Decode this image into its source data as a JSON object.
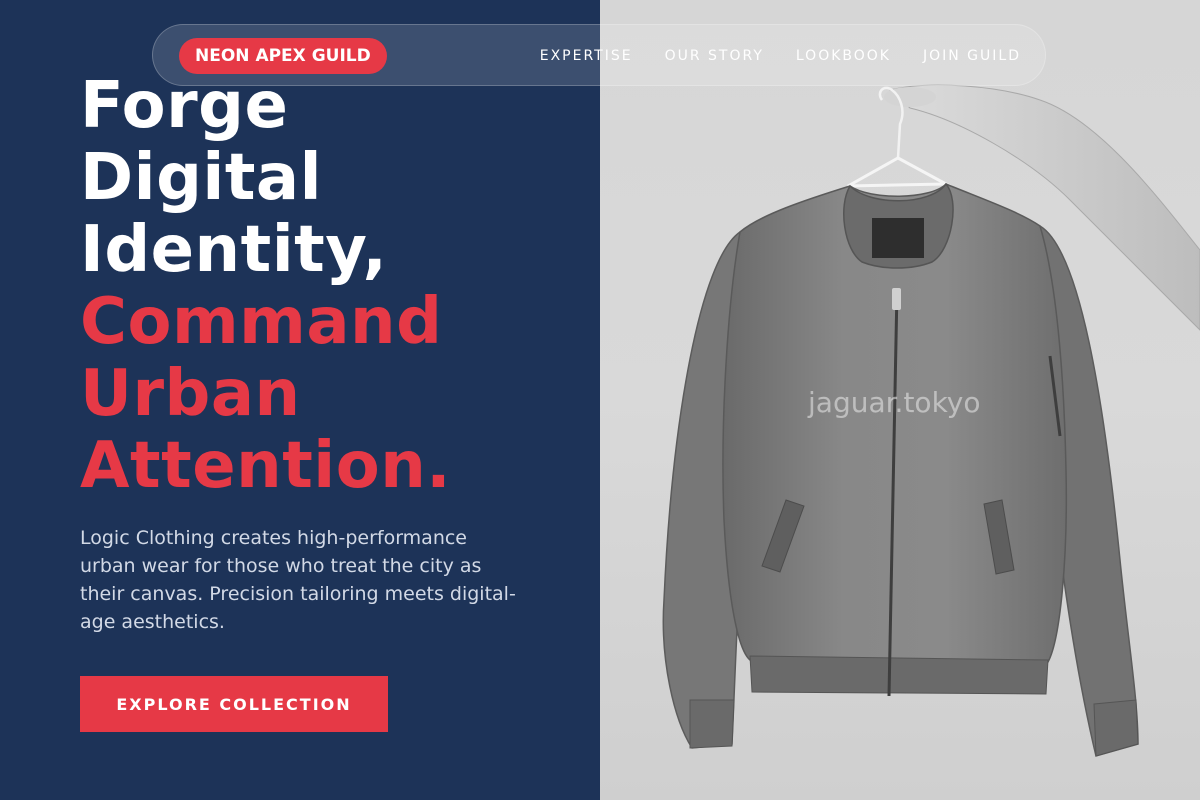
{
  "brand": {
    "logo_text": "NEON APEX GUILD",
    "accent_color": "#e63946",
    "panel_color": "#1d3358"
  },
  "nav": {
    "links": [
      "EXPERTISE",
      "OUR STORY",
      "LOOKBOOK",
      "JOIN GUILD"
    ]
  },
  "hero": {
    "headline_lines": [
      {
        "text": "Forge",
        "color": "white"
      },
      {
        "text": "Digital",
        "color": "white"
      },
      {
        "text": "Identity,",
        "color": "white"
      },
      {
        "text": "Command",
        "color": "red"
      },
      {
        "text": "Urban",
        "color": "red"
      },
      {
        "text": "Attention.",
        "color": "red"
      }
    ],
    "body_text": "Logic Clothing creates high-performance urban wear for those who treat the city as their canvas. Precision tailoring meets digital-age aesthetics.",
    "cta_label": "EXPLORE COLLECTION"
  },
  "photo": {
    "watermark": "jaguar.tokyo",
    "icon": "bomber-jacket-on-hanger"
  }
}
